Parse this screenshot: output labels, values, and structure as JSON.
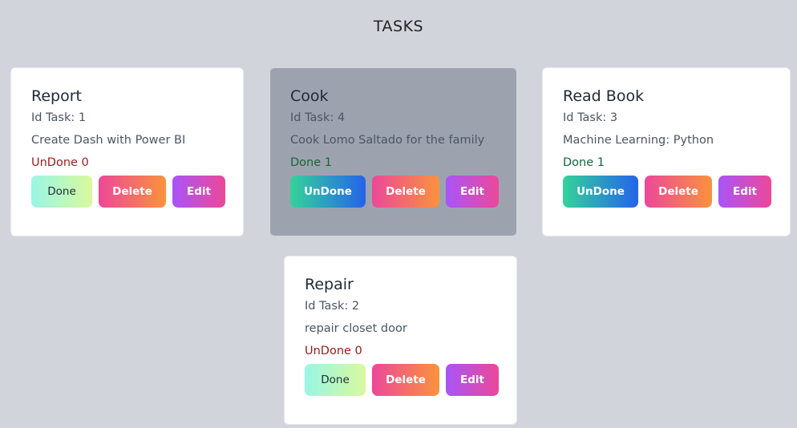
{
  "header": {
    "title": "TASKS"
  },
  "tasks": [
    {
      "title": "Report",
      "id_text": "Id Task: 1",
      "description": "Create Dash with Power BI",
      "status_text": "UnDone 0",
      "toggle_label": "Done",
      "delete_label": "Delete",
      "edit_label": "Edit"
    },
    {
      "title": "Cook",
      "id_text": "Id Task: 4",
      "description": "Cook Lomo Saltado for the family",
      "status_text": "Done 1",
      "toggle_label": "UnDone",
      "delete_label": "Delete",
      "edit_label": "Edit"
    },
    {
      "title": "Read Book",
      "id_text": "Id Task: 3",
      "description": "Machine Learning: Python",
      "status_text": "Done 1",
      "toggle_label": "UnDone",
      "delete_label": "Delete",
      "edit_label": "Edit"
    },
    {
      "title": "Repair",
      "id_text": "Id Task: 2",
      "description": "repair closet door",
      "status_text": "UnDone 0",
      "toggle_label": "Done",
      "delete_label": "Delete",
      "edit_label": "Edit"
    }
  ],
  "colors": {
    "background": "#d1d5db",
    "card": "#ffffff",
    "card_done_highlight": "#9ca3af",
    "undone_text": "#991b1b",
    "done_text": "#166534"
  }
}
